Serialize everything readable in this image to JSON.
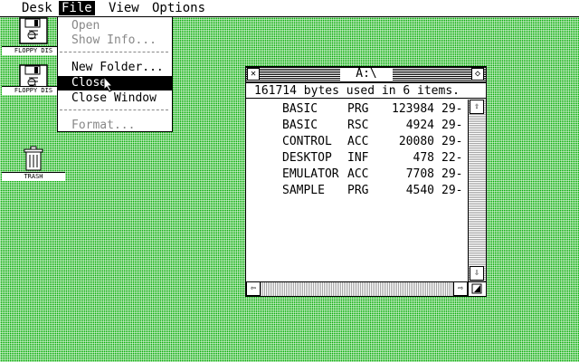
{
  "menubar": {
    "items": [
      "Desk",
      "File",
      "View",
      "Options"
    ],
    "active": "File"
  },
  "file_menu": {
    "items": [
      {
        "label": "Open",
        "enabled": false
      },
      {
        "label": "Show Info...",
        "enabled": false
      },
      {
        "label": "New Folder...",
        "enabled": true
      },
      {
        "label": "Close",
        "enabled": true,
        "highlighted": true
      },
      {
        "label": "Close Window",
        "enabled": true
      },
      {
        "label": "Format...",
        "enabled": false
      }
    ]
  },
  "desktop": {
    "icons": [
      {
        "label": "FLOPPY DIS",
        "kind": "floppy-disk-icon"
      },
      {
        "label": "FLOPPY DIS",
        "kind": "floppy-disk-icon"
      },
      {
        "label": "TRASH",
        "kind": "trash-can-icon"
      }
    ]
  },
  "window": {
    "title": "A:\\",
    "info": "161714 bytes used in 6 items.",
    "files": [
      {
        "name": "BASIC",
        "ext": "PRG",
        "size": "123984",
        "date": "29-"
      },
      {
        "name": "BASIC",
        "ext": "RSC",
        "size": "4924",
        "date": "29-"
      },
      {
        "name": "CONTROL",
        "ext": "ACC",
        "size": "20080",
        "date": "29-"
      },
      {
        "name": "DESKTOP",
        "ext": "INF",
        "size": "478",
        "date": "22-"
      },
      {
        "name": "EMULATOR",
        "ext": "ACC",
        "size": "7708",
        "date": "29-"
      },
      {
        "name": "SAMPLE",
        "ext": "PRG",
        "size": "4540",
        "date": "29-"
      }
    ]
  }
}
